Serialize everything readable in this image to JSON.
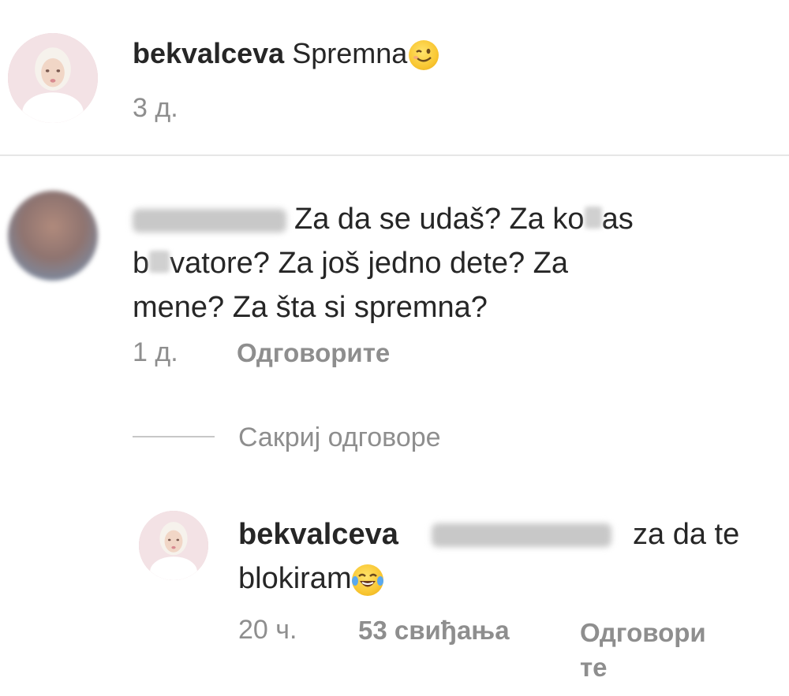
{
  "post_caption": {
    "username": "bekvalceva",
    "text": "Spremna",
    "emoji": "winking-face-icon",
    "time": "3 д."
  },
  "comment": {
    "text_line1": "Za da se udaš? Za ko",
    "text_line1_end": "as",
    "text_line2_start": "b",
    "text_line2_end": "vatore? Za još jedno dete? Za",
    "text_line3": "mene? Za šta si spremna?",
    "time": "1 д.",
    "reply_label": "Одговорите"
  },
  "replies_toggle": {
    "label": "Сакриј одговоре"
  },
  "reply": {
    "username": "bekvalceva",
    "text_part1": "za da te",
    "text_part2": "blokiram",
    "emoji": "tears-of-joy-icon",
    "time": "20 ч.",
    "likes": "53 свиђања",
    "reply_label_line1": "Одговори",
    "reply_label_line2": "те"
  },
  "colors": {
    "text": "#262626",
    "meta": "#8e8e8e",
    "divider": "#e6e6e6"
  }
}
